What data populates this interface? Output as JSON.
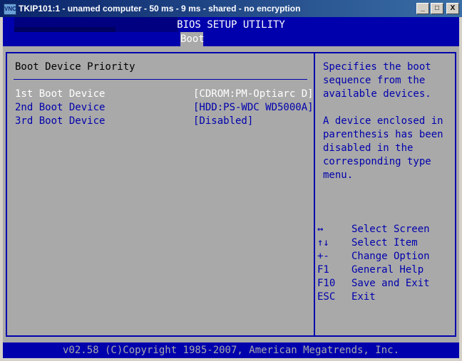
{
  "window": {
    "icon": "vnc-icon",
    "title": "TKIP101:1 - unamed computer - 50 ms - 9 ms - shared - no encryption",
    "buttons": {
      "minimize": "_",
      "maximize": "□",
      "close": "X"
    }
  },
  "bios": {
    "title": "BIOS SETUP UTILITY",
    "active_tab": "Boot",
    "section_title": "Boot Device Priority",
    "options": [
      {
        "label": "1st Boot Device",
        "value": "[CDROM:PM-Optiarc D]"
      },
      {
        "label": "2nd Boot Device",
        "value": "[HDD:PS-WDC WD5000A]"
      },
      {
        "label": "3rd Boot Device",
        "value": "[Disabled]"
      }
    ],
    "help_text": "Specifies the boot\nsequence from the\navailable devices.\n\nA device enclosed in\nparenthesis has been\ndisabled in the\ncorresponding type\nmenu.",
    "keys": [
      {
        "key": "↔",
        "desc": "Select Screen"
      },
      {
        "key": "↑↓",
        "desc": "Select Item"
      },
      {
        "key": "+-",
        "desc": "Change Option"
      },
      {
        "key": "F1",
        "desc": "General Help"
      },
      {
        "key": "F10",
        "desc": "Save and Exit"
      },
      {
        "key": "ESC",
        "desc": "Exit"
      }
    ],
    "footer": "v02.58 (C)Copyright 1985-2007, American Megatrends, Inc."
  },
  "colors": {
    "bios_blue": "#0000ad",
    "bios_gray": "#a9a9a9",
    "title_bar": "#0a246a"
  }
}
